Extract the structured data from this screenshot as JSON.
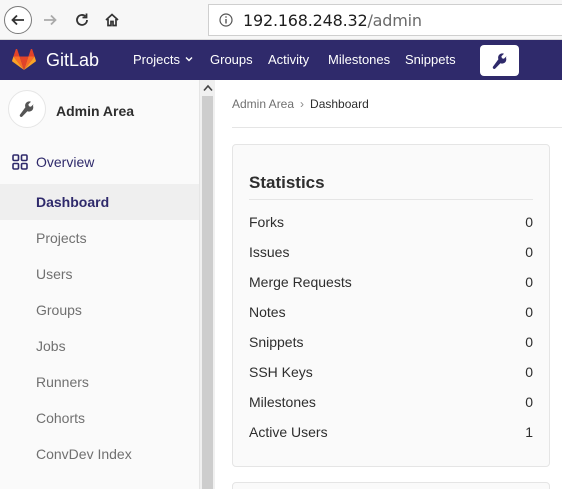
{
  "browser": {
    "url_host": "192.168.248.32",
    "url_path": "/admin",
    "icons": [
      "back-arrow-icon",
      "forward-arrow-icon",
      "reload-icon",
      "home-icon",
      "info-icon"
    ]
  },
  "header": {
    "brand": "GitLab",
    "nav": {
      "projects": "Projects",
      "groups": "Groups",
      "activity": "Activity",
      "milestones": "Milestones",
      "snippets": "Snippets"
    },
    "colors": {
      "background": "#2f2a6b",
      "logo": "#fc6d26"
    }
  },
  "sidebar": {
    "context_title": "Admin Area",
    "overview_label": "Overview",
    "items": [
      {
        "label": "Dashboard",
        "active": true
      },
      {
        "label": "Projects",
        "active": false
      },
      {
        "label": "Users",
        "active": false
      },
      {
        "label": "Groups",
        "active": false
      },
      {
        "label": "Jobs",
        "active": false
      },
      {
        "label": "Runners",
        "active": false
      },
      {
        "label": "Cohorts",
        "active": false
      },
      {
        "label": "ConvDev Index",
        "active": false
      }
    ]
  },
  "breadcrumb": {
    "parent": "Admin Area",
    "separator": "›",
    "current": "Dashboard"
  },
  "statistics": {
    "title": "Statistics",
    "rows": [
      {
        "label": "Forks",
        "value": "0"
      },
      {
        "label": "Issues",
        "value": "0"
      },
      {
        "label": "Merge Requests",
        "value": "0"
      },
      {
        "label": "Notes",
        "value": "0"
      },
      {
        "label": "Snippets",
        "value": "0"
      },
      {
        "label": "SSH Keys",
        "value": "0"
      },
      {
        "label": "Milestones",
        "value": "0"
      },
      {
        "label": "Active Users",
        "value": "1"
      }
    ]
  }
}
